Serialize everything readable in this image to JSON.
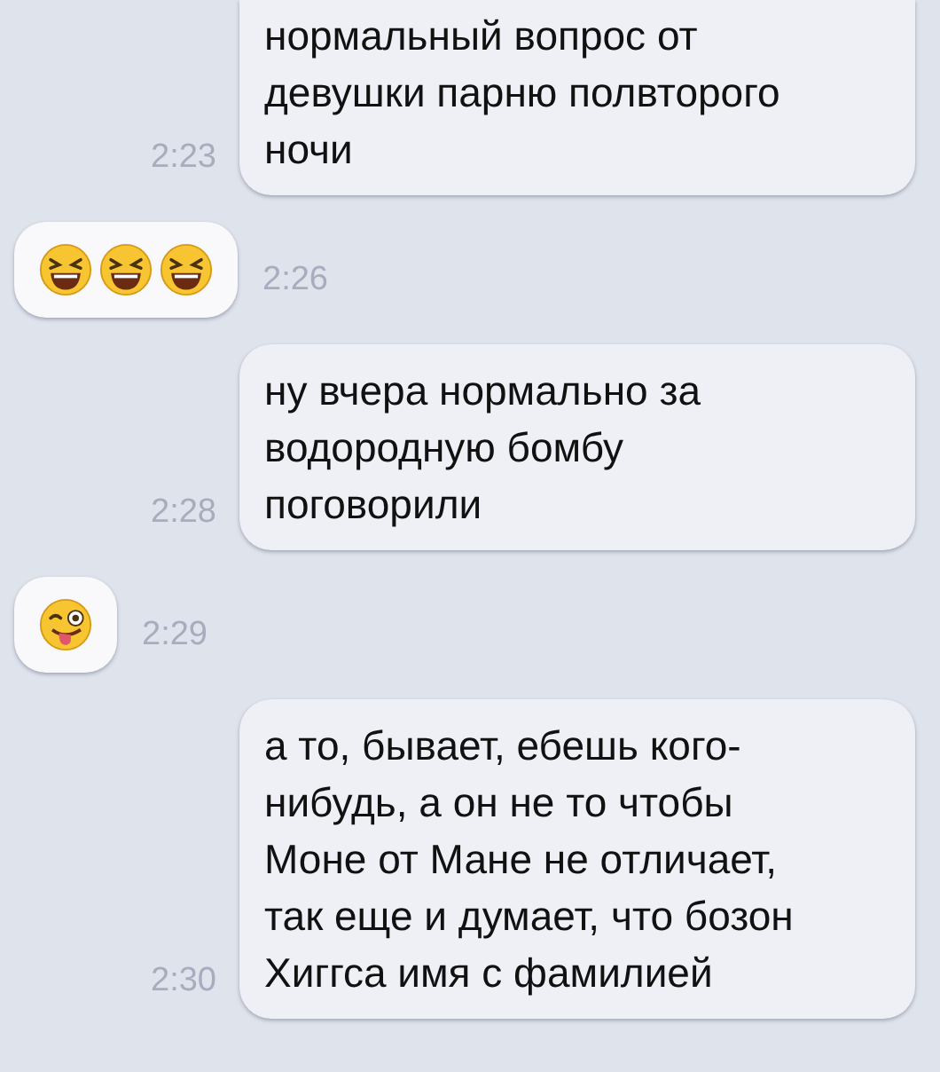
{
  "messages": [
    {
      "kind": "text",
      "outgoing": true,
      "lines": [
        "нормальный вопрос от",
        "девушки парню полвторого",
        "ночи"
      ],
      "time": "2:23"
    },
    {
      "kind": "emoji",
      "outgoing": false,
      "icons": [
        {
          "kind": "laughing"
        },
        {
          "kind": "laughing"
        },
        {
          "kind": "laughing"
        }
      ],
      "time": "2:26"
    },
    {
      "kind": "text",
      "outgoing": true,
      "lines": [
        "ну вчера нормально за",
        "водородную бомбу",
        "поговорили"
      ],
      "time": "2:28"
    },
    {
      "kind": "emoji",
      "outgoing": false,
      "icons": [
        {
          "kind": "winking-tongue"
        }
      ],
      "time": "2:29"
    },
    {
      "kind": "text",
      "outgoing": true,
      "lines": [
        "а то, бывает, ебешь кого-",
        "нибудь, а он не то чтобы",
        "Моне от Мане не отличает,",
        "так еще и думает, что бозон",
        "Хиггса имя с фамилией"
      ],
      "time": "2:30"
    }
  ]
}
